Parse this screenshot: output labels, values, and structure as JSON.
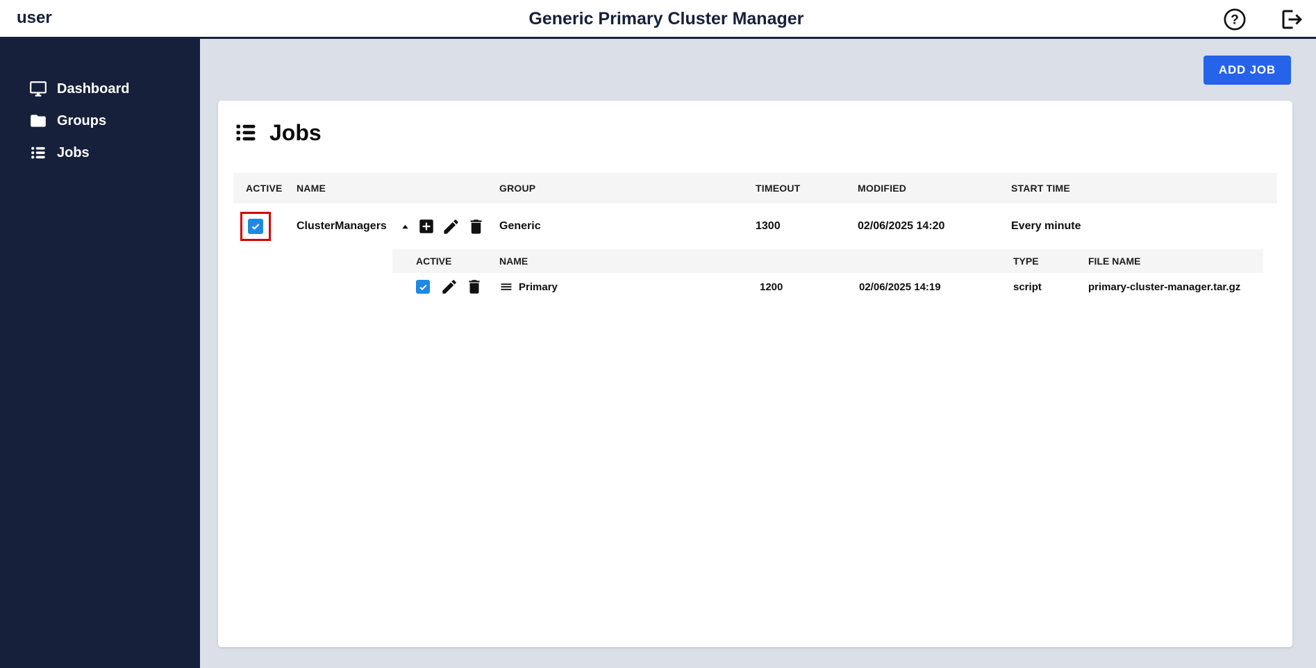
{
  "header": {
    "user_label": "user",
    "title": "Generic Primary Cluster Manager",
    "icons": [
      "help-icon",
      "logout-icon"
    ]
  },
  "sidebar": {
    "items": [
      {
        "label": "Dashboard",
        "icon": "monitor-icon"
      },
      {
        "label": "Groups",
        "icon": "folder-icon"
      },
      {
        "label": "Jobs",
        "icon": "list-icon"
      }
    ]
  },
  "toolbar": {
    "add_job_label": "ADD JOB"
  },
  "jobs": {
    "title": "Jobs",
    "title_icon": "list-icon",
    "table": {
      "headers": [
        "ACTIVE",
        "NAME",
        "GROUP",
        "TIMEOUT",
        "MODIFIED",
        "START TIME"
      ],
      "rows": [
        {
          "active": true,
          "name": "ClusterManagers",
          "group": "Generic",
          "timeout": "1300",
          "modified": "02/06/2025 14:20",
          "start_time": "Every minute",
          "actions": [
            "collapse-icon",
            "add-box-icon",
            "edit-icon",
            "delete-icon"
          ],
          "highlighted": true
        }
      ]
    },
    "subtable": {
      "headers": [
        "ACTIVE",
        "NAME",
        "TYPE",
        "FILE NAME"
      ],
      "rows": [
        {
          "active": true,
          "name": "Primary",
          "timeout": "1200",
          "modified": "02/06/2025 14:19",
          "type": "script",
          "file_name": "primary-cluster-manager.tar.gz",
          "actions": [
            "edit-icon",
            "delete-icon",
            "drag-handle-icon"
          ]
        }
      ]
    }
  },
  "colors": {
    "navy": "#16203A",
    "page_background": "#DBE0E8",
    "accent_blue": "#2563EB",
    "checkbox_blue": "#1E88E5",
    "band_gray": "#F5F5F5",
    "highlight_red": "#D20000"
  }
}
